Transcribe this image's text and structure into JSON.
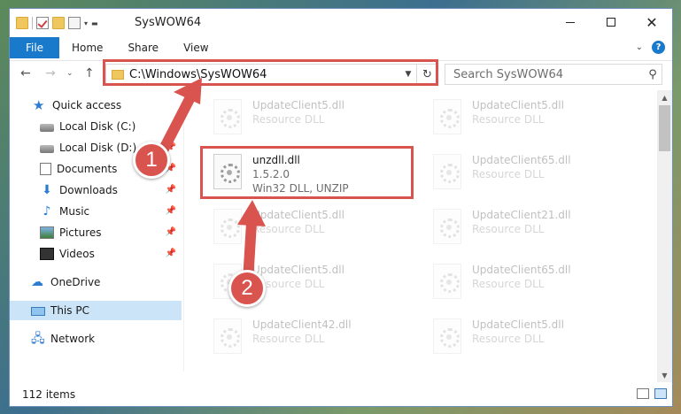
{
  "window": {
    "title": "SysWOW64"
  },
  "ribbon": {
    "tabs": [
      "File",
      "Home",
      "Share",
      "View"
    ],
    "help_label": "?"
  },
  "nav": {
    "address": "C:\\Windows\\SysWOW64",
    "search_placeholder": "Search SysWOW64"
  },
  "sidebar": {
    "items": [
      {
        "label": "Quick access",
        "icon": "star-icon"
      },
      {
        "label": "Local Disk (C:)",
        "icon": "disk-icon"
      },
      {
        "label": "Local Disk (D:)",
        "icon": "disk-icon"
      },
      {
        "label": "Documents",
        "icon": "documents-icon"
      },
      {
        "label": "Downloads",
        "icon": "downloads-icon"
      },
      {
        "label": "Music",
        "icon": "music-icon"
      },
      {
        "label": "Pictures",
        "icon": "pictures-icon"
      },
      {
        "label": "Videos",
        "icon": "videos-icon"
      },
      {
        "label": "OneDrive",
        "icon": "cloud-icon"
      },
      {
        "label": "This PC",
        "icon": "computer-icon"
      },
      {
        "label": "Network",
        "icon": "network-icon"
      }
    ]
  },
  "files": [
    {
      "name": "UpdateClient5.dll",
      "type": "Resource DLL"
    },
    {
      "name": "UpdateClient5.dll",
      "type": "Resource DLL"
    },
    {
      "name": "unzdll.dll",
      "version": "1.5.2.0",
      "desc": "Win32 DLL, UNZIP"
    },
    {
      "name": "UpdateClient65.dll",
      "type": "Resource DLL"
    },
    {
      "name": "UpdateClient5.dll",
      "type": "Resource DLL"
    },
    {
      "name": "UpdateClient21.dll",
      "type": "Resource DLL"
    },
    {
      "name": "UpdateClient5.dll",
      "type": "Resource DLL"
    },
    {
      "name": "UpdateClient65.dll",
      "type": "Resource DLL"
    },
    {
      "name": "UpdateClient42.dll",
      "type": "Resource DLL"
    },
    {
      "name": "UpdateClient5.dll",
      "type": "Resource DLL"
    }
  ],
  "status": {
    "items_count": "112 items"
  },
  "annotations": {
    "step1": "1",
    "step2": "2",
    "color": "#d9534f"
  }
}
